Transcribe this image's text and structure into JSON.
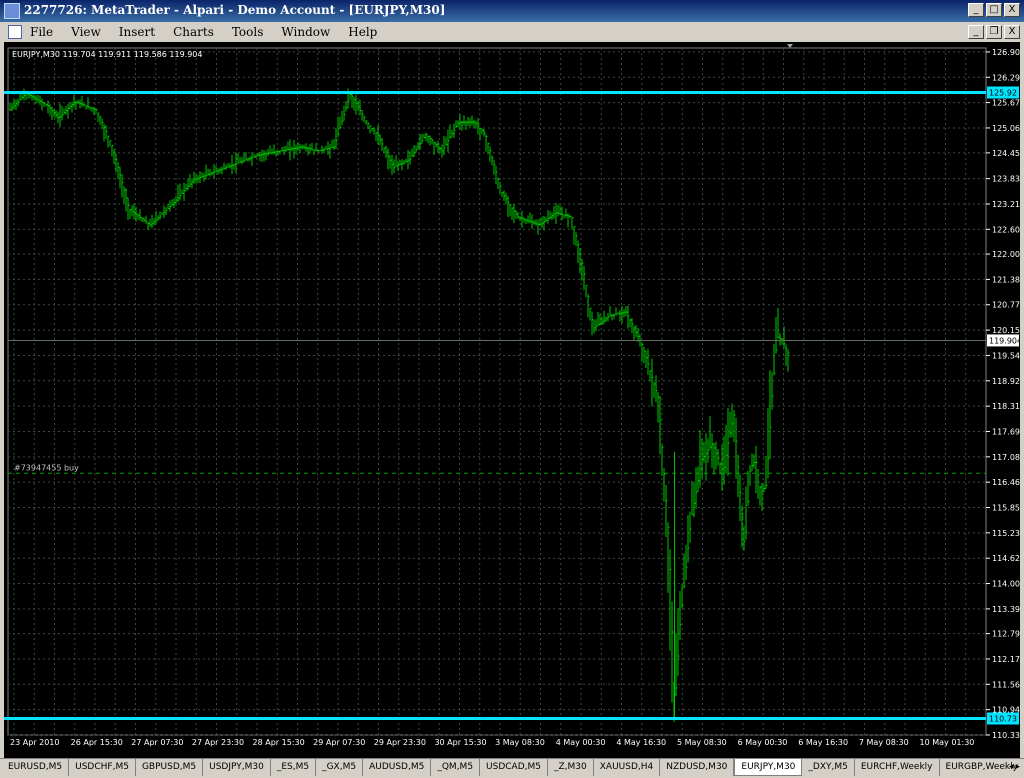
{
  "window": {
    "title": "2277726: MetaTrader - Alpari - Demo Account - [EURJPY,M30]",
    "buttons": {
      "minimize": "_",
      "maximize": "□",
      "close": "X",
      "mdi_minimize": "_",
      "mdi_restore": "❐",
      "mdi_close": "X"
    }
  },
  "menu": {
    "items": [
      "File",
      "View",
      "Insert",
      "Charts",
      "Tools",
      "Window",
      "Help"
    ]
  },
  "chart_data": {
    "type": "bar",
    "info_line": "EURJPY,M30  119.704 119.911 119.586 119.904",
    "order_label": "#73947455 buy",
    "grid": true,
    "background": "#000000",
    "bar_color": "#00c800",
    "grid_color": "#3a4a3a",
    "ylim": [
      110.33,
      127.0
    ],
    "y_ticks": [
      126.905,
      126.29,
      125.675,
      125.06,
      124.455,
      123.83,
      123.215,
      122.6,
      122.0,
      121.385,
      120.77,
      120.155,
      119.54,
      118.925,
      118.31,
      117.695,
      117.08,
      116.465,
      115.85,
      115.235,
      114.62,
      114.005,
      113.39,
      112.79,
      112.175,
      111.56,
      110.945,
      110.33
    ],
    "x_ticks": [
      "23 Apr 2010",
      "26 Apr 15:30",
      "27 Apr 07:30",
      "27 Apr 23:30",
      "28 Apr 15:30",
      "29 Apr 07:30",
      "29 Apr 23:30",
      "30 Apr 15:30",
      "3 May 08:30",
      "4 May 00:30",
      "4 May 16:30",
      "5 May 08:30",
      "6 May 00:30",
      "6 May 16:30",
      "7 May 08:30",
      "10 May 01:30"
    ],
    "price_path": [
      [
        0,
        125.5
      ],
      [
        3,
        125.9
      ],
      [
        7,
        125.6
      ],
      [
        9,
        125.3
      ],
      [
        12,
        125.7
      ],
      [
        16,
        125.5
      ],
      [
        19,
        124.6
      ],
      [
        22,
        123.1
      ],
      [
        26,
        122.7
      ],
      [
        30,
        123.2
      ],
      [
        34,
        123.8
      ],
      [
        38,
        124.0
      ],
      [
        42,
        124.2
      ],
      [
        46,
        124.4
      ],
      [
        50,
        124.5
      ],
      [
        54,
        124.6
      ],
      [
        57,
        124.5
      ],
      [
        60,
        124.6
      ],
      [
        63,
        125.9
      ],
      [
        66,
        125.2
      ],
      [
        68,
        124.9
      ],
      [
        71,
        124.1
      ],
      [
        74,
        124.3
      ],
      [
        77,
        124.9
      ],
      [
        80,
        124.5
      ],
      [
        83,
        125.2
      ],
      [
        86,
        125.2
      ],
      [
        88,
        124.9
      ],
      [
        91,
        123.5
      ],
      [
        94,
        122.9
      ],
      [
        98,
        122.7
      ],
      [
        101,
        123.0
      ],
      [
        104,
        122.9
      ],
      [
        106,
        121.7
      ],
      [
        108,
        120.2
      ],
      [
        111,
        120.5
      ],
      [
        114,
        120.6
      ],
      [
        117,
        119.8
      ],
      [
        120,
        118.5
      ],
      [
        122,
        115.0
      ],
      [
        123,
        110.9
      ],
      [
        124,
        113.0
      ],
      [
        126,
        115.5
      ],
      [
        128,
        117.0
      ],
      [
        130,
        117.4
      ],
      [
        132,
        116.7
      ],
      [
        133,
        117.5
      ],
      [
        134,
        118.1
      ],
      [
        135,
        116.4
      ],
      [
        136,
        114.8
      ],
      [
        137,
        116.8
      ],
      [
        138,
        117.0
      ],
      [
        139,
        116.2
      ],
      [
        140,
        116.4
      ],
      [
        141,
        118.5
      ],
      [
        142,
        120.0
      ],
      [
        143,
        119.9
      ],
      [
        144,
        119.6
      ]
    ],
    "horizontal_lines": [
      {
        "label": "125.92",
        "value": 125.92,
        "color": "#00e5ff"
      },
      {
        "label": "110.73",
        "value": 110.73,
        "color": "#00e5ff"
      }
    ],
    "bid_line": {
      "label": "119.904",
      "value": 119.904,
      "color": "#607060"
    },
    "order_line": {
      "value": 116.68,
      "color": "#00a000"
    }
  },
  "tabs": [
    "EURUSD,M5",
    "USDCHF,M5",
    "GBPUSD,M5",
    "USDJPY,M30",
    "_ES,M5",
    "_GX,M5",
    "AUDUSD,M5",
    "_QM,M5",
    "USDCAD,M5",
    "_Z,M30",
    "XAUUSD,H4",
    "NZDUSD,M30",
    "EURJPY,M30",
    "_DXY,M5",
    "EURCHF,Weekly",
    "EURGBP,Weekly"
  ],
  "active_tab": "EURJPY,M30",
  "tab_nav": {
    "left": "◂",
    "right": "▸"
  }
}
